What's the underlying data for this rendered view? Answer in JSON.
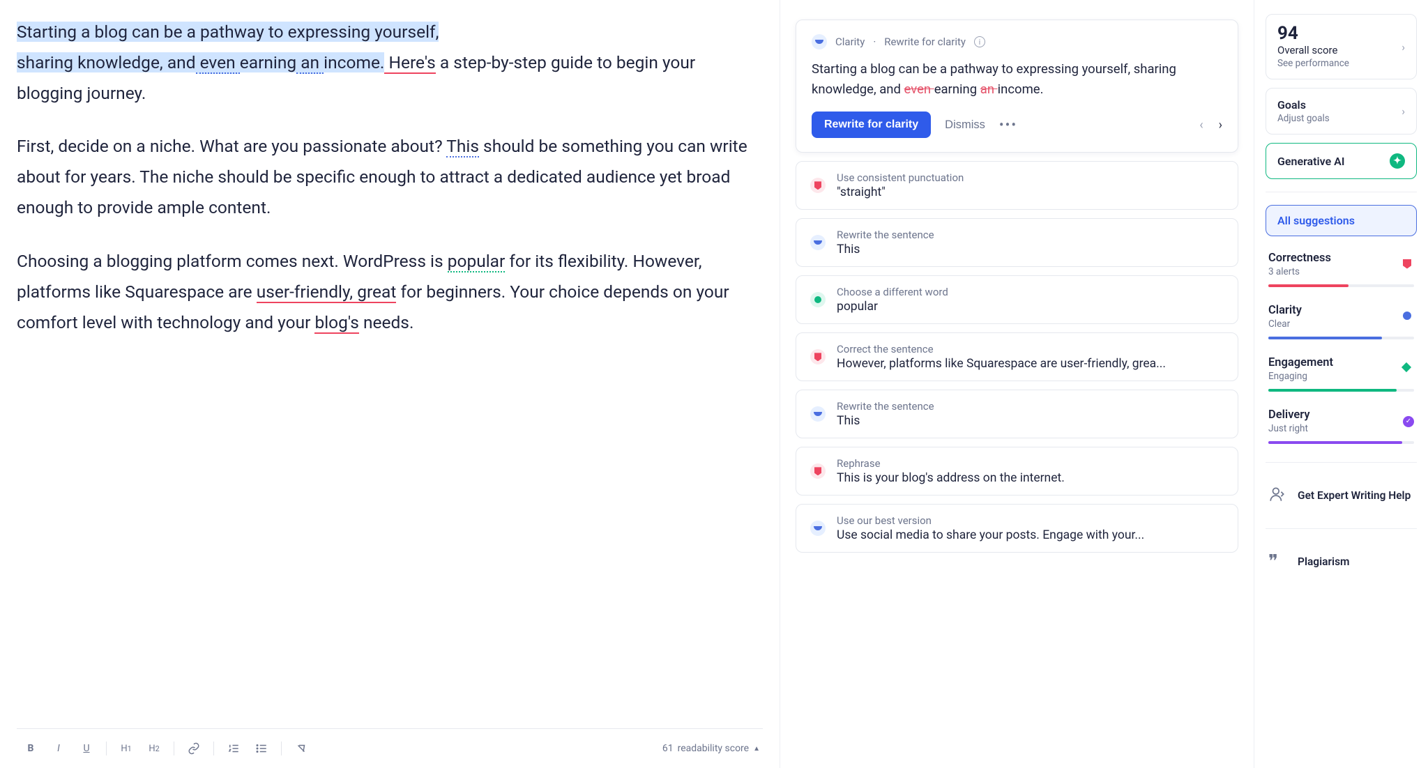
{
  "editor": {
    "para1_highlight": "Starting a blog can be a pathway to expressing yourself,",
    "para1_line2a": "sharing knowledge, and",
    "para1_even": " even ",
    "para1_earning": "earning",
    "para1_an": " an ",
    "para1_income": "income.",
    "para1_heres": " Here's",
    "para1_line3": "a step-by-step guide to begin your blogging journey.",
    "para2_a": "First, decide on a niche. What are you passionate about?",
    "para2_this": "This",
    "para2_b": " should be something you can write about for years. The niche should be specific enough to attract a dedicated audience yet broad enough to provide ample content.",
    "para3_a": "Choosing a blogging platform comes next. WordPress is ",
    "para3_popular": "popular",
    "para3_b": " for its flexibility. However, platforms like Squarespace are ",
    "para3_uf": "user-friendly,",
    "para3_great": " great",
    "para3_c": " for beginners. Your choice depends on your comfort level with technology and your ",
    "para3_blogs": "blog's",
    "para3_d": " needs."
  },
  "toolbar": {
    "readability_score": "61",
    "readability_label": "readability score"
  },
  "card": {
    "category": "Clarity",
    "sep": "·",
    "title": "Rewrite for clarity",
    "body_a": "Starting a blog can be a pathway to expressing yourself, sharing knowledge, and ",
    "body_strike1": "even ",
    "body_b": "earning ",
    "body_strike2": "an ",
    "body_c": "income.",
    "action_primary": "Rewrite for clarity",
    "action_dismiss": "Dismiss"
  },
  "suggestions": [
    {
      "dot": "red",
      "title": "Use consistent punctuation",
      "preview": "\"straight\""
    },
    {
      "dot": "blue",
      "title": "Rewrite the sentence",
      "preview": "This"
    },
    {
      "dot": "green",
      "title": "Choose a different word",
      "preview": "popular"
    },
    {
      "dot": "red",
      "title": "Correct the sentence",
      "preview": "However, platforms like Squarespace are user-friendly, grea..."
    },
    {
      "dot": "blue",
      "title": "Rewrite the sentence",
      "preview": "This"
    },
    {
      "dot": "red",
      "title": "Rephrase",
      "preview": "This is your blog's address on the internet."
    },
    {
      "dot": "blue",
      "title": "Use our best version",
      "preview": "Use social media to share your posts. Engage with your..."
    }
  ],
  "sidebar": {
    "score": "94",
    "score_label": "Overall score",
    "score_sub": "See performance",
    "goals_label": "Goals",
    "goals_sub": "Adjust goals",
    "gen_ai": "Generative AI",
    "all_suggestions": "All suggestions",
    "categories": [
      {
        "name": "Correctness",
        "sub": "3 alerts",
        "color": "#ee445f",
        "fill": 55,
        "icon": "shield-red"
      },
      {
        "name": "Clarity",
        "sub": "Clear",
        "color": "#4a6ee0",
        "fill": 78,
        "icon": "circle-blue"
      },
      {
        "name": "Engagement",
        "sub": "Engaging",
        "color": "#0fb880",
        "fill": 88,
        "icon": "diamond-green"
      },
      {
        "name": "Delivery",
        "sub": "Just right",
        "color": "#8a4af0",
        "fill": 92,
        "icon": "check-purple"
      }
    ],
    "expert_help": "Get Expert Writing Help",
    "plagiarism": "Plagiarism"
  }
}
